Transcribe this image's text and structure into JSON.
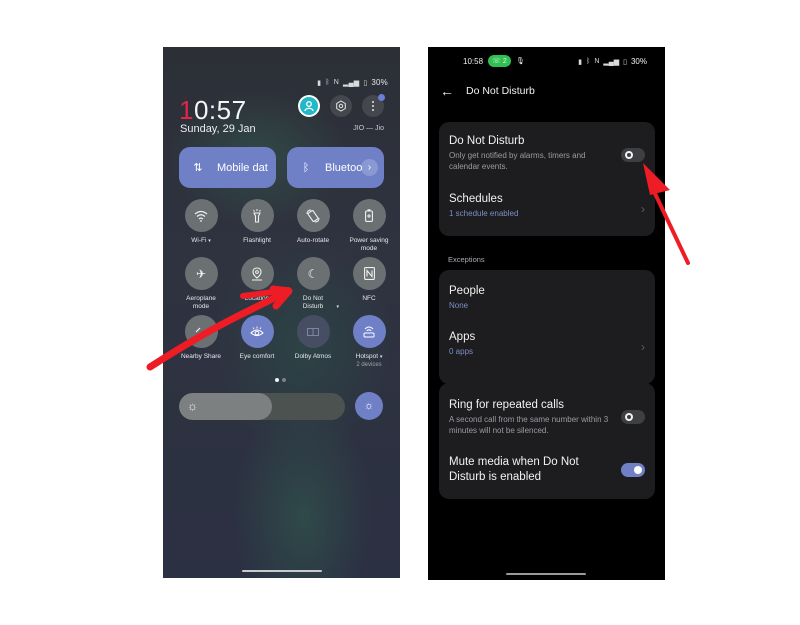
{
  "left_phone": {
    "status_bar": {
      "icons": [
        "vibrate-icon",
        "bluetooth-icon",
        "nfc-icon",
        "signal-icon",
        "battery-icon"
      ],
      "battery": "30%"
    },
    "clock": {
      "first_digit": "1",
      "rest": "0:57"
    },
    "date": "Sunday, 29 Jan",
    "carrier": "JIO — Jio",
    "big_tiles": [
      {
        "icon": "mobile-data-icon",
        "label": "Mobile dat",
        "state": "on"
      },
      {
        "icon": "bluetooth-icon",
        "label": "Bluetoot",
        "state": "on"
      }
    ],
    "tiles": [
      {
        "icon": "wifi-icon",
        "label": "Wi-Fi",
        "caret": true,
        "state": "off"
      },
      {
        "icon": "flashlight-icon",
        "label": "Flashlight",
        "state": "off"
      },
      {
        "icon": "auto-rotate-icon",
        "label": "Auto-rotate",
        "state": "off"
      },
      {
        "icon": "power-saving-icon",
        "label": "Power saving",
        "label2": "mode",
        "state": "off"
      },
      {
        "icon": "airplane-icon",
        "label": "Aeroplane",
        "label2": "mode",
        "state": "off"
      },
      {
        "icon": "location-icon",
        "label": "Location",
        "state": "off"
      },
      {
        "icon": "moon-icon",
        "label": "Do Not",
        "label2": "Disturb",
        "caret": true,
        "state": "off"
      },
      {
        "icon": "nfc-icon",
        "label": "NFC",
        "state": "off"
      },
      {
        "icon": "nearby-share-icon",
        "label": "Nearby Share",
        "state": "off"
      },
      {
        "icon": "eye-icon",
        "label": "Eye comfort",
        "state": "on"
      },
      {
        "icon": "dolby-icon",
        "label": "Dolby Atmos",
        "state": "disabled"
      },
      {
        "icon": "hotspot-icon",
        "label": "Hotspot",
        "caret": true,
        "sub": "2 devices",
        "state": "on"
      }
    ],
    "pager": {
      "pages": 2,
      "current": 1
    },
    "brightness": {
      "level_percent": 56
    },
    "accent": "#6f80c7"
  },
  "right_phone": {
    "status_bar": {
      "time": "10:58",
      "pill": "2",
      "battery": "30%"
    },
    "header": {
      "back_label": "←",
      "title": "Do Not Disturb"
    },
    "card1": {
      "dnd": {
        "title": "Do Not Disturb",
        "desc": "Only get notified by alarms, timers and calendar events.",
        "enabled": false
      },
      "schedules": {
        "title": "Schedules",
        "sub": "1 schedule enabled"
      }
    },
    "exceptions_label": "Exceptions",
    "card2": {
      "people": {
        "title": "People",
        "sub": "None"
      },
      "apps": {
        "title": "Apps",
        "sub": "0 apps"
      }
    },
    "card3": {
      "repeat_calls": {
        "title": "Ring for repeated calls",
        "desc": "A second call from the same number within 3 minutes will not be silenced.",
        "enabled": false
      },
      "mute_media": {
        "title": "Mute media when Do Not Disturb is enabled",
        "enabled": true
      }
    },
    "accent": "#6f80c7"
  },
  "annotations": {
    "arrow_color": "#ee1c25"
  }
}
